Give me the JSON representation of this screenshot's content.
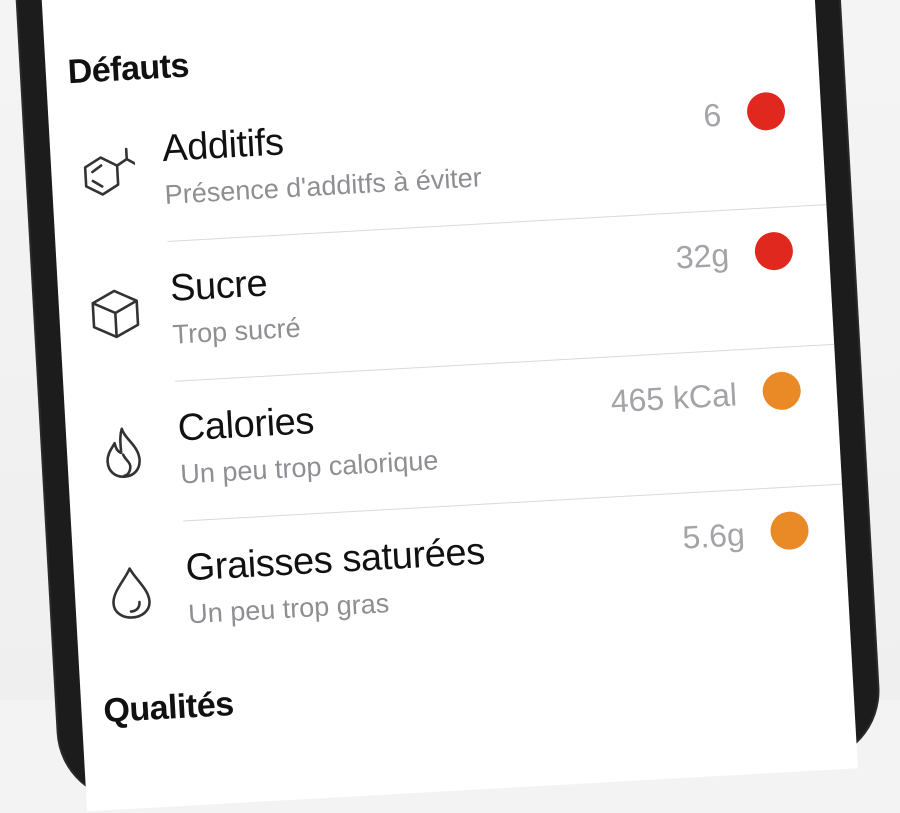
{
  "sections": {
    "defects_title": "Défauts",
    "qualities_title": "Qualités"
  },
  "defects": [
    {
      "label": "Additifs",
      "sub": "Présence d'additfs à éviter",
      "value": "6",
      "status_color": "#e0281e",
      "icon": "additives-molecule-icon"
    },
    {
      "label": "Sucre",
      "sub": "Trop sucré",
      "value": "32g",
      "status_color": "#e0281e",
      "icon": "sugar-cube-icon"
    },
    {
      "label": "Calories",
      "sub": "Un peu trop calorique",
      "value": "465 kCal",
      "status_color": "#ea8a26",
      "icon": "flame-icon"
    },
    {
      "label": "Graisses saturées",
      "sub": "Un peu trop gras",
      "value": "5.6g",
      "status_color": "#ea8a26",
      "icon": "drop-icon"
    }
  ]
}
